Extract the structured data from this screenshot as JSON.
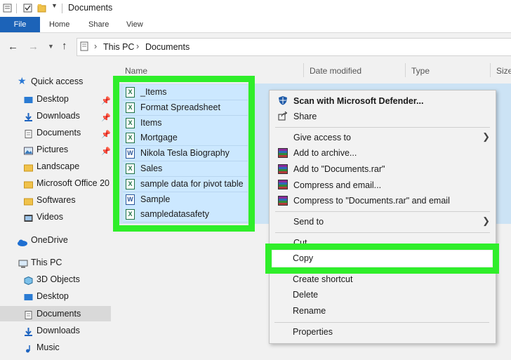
{
  "window": {
    "title": "Documents"
  },
  "ribbon": {
    "tabs": [
      "File",
      "Home",
      "Share",
      "View"
    ]
  },
  "address": {
    "path": [
      "This PC",
      "Documents"
    ]
  },
  "columns": {
    "name": "Name",
    "date": "Date modified",
    "type": "Type",
    "size": "Size"
  },
  "nav": {
    "quick_access": "Quick access",
    "quick_items": [
      "Desktop",
      "Downloads",
      "Documents",
      "Pictures",
      "Landscape",
      "Microsoft Office 20",
      "Softwares",
      "Videos"
    ],
    "onedrive": "OneDrive",
    "this_pc": "This PC",
    "pc_items": [
      "3D Objects",
      "Desktop",
      "Documents",
      "Downloads",
      "Music"
    ]
  },
  "files": [
    {
      "name": "_Items",
      "kind": "excel"
    },
    {
      "name": "Format Spreadsheet",
      "kind": "excel"
    },
    {
      "name": "Items",
      "kind": "excel"
    },
    {
      "name": "Mortgage",
      "kind": "excel"
    },
    {
      "name": "Nikola Tesla Biography",
      "kind": "word"
    },
    {
      "name": "Sales",
      "kind": "excel"
    },
    {
      "name": "sample data for pivot table",
      "kind": "excel"
    },
    {
      "name": "Sample",
      "kind": "word"
    },
    {
      "name": "sampledatasafety",
      "kind": "excel"
    }
  ],
  "context_menu": {
    "scan": "Scan with Microsoft Defender...",
    "share": "Share",
    "give_access": "Give access to",
    "add_archive": "Add to archive...",
    "add_rar": "Add to \"Documents.rar\"",
    "compress_email": "Compress and email...",
    "compress_rar_email": "Compress to \"Documents.rar\" and email",
    "send_to": "Send to",
    "cut": "Cut",
    "copy": "Copy",
    "create_shortcut": "Create shortcut",
    "delete": "Delete",
    "rename": "Rename",
    "properties": "Properties"
  },
  "colors": {
    "accent": "#1c63b8",
    "highlight": "#2fee2a",
    "selection": "#cce8ff"
  }
}
